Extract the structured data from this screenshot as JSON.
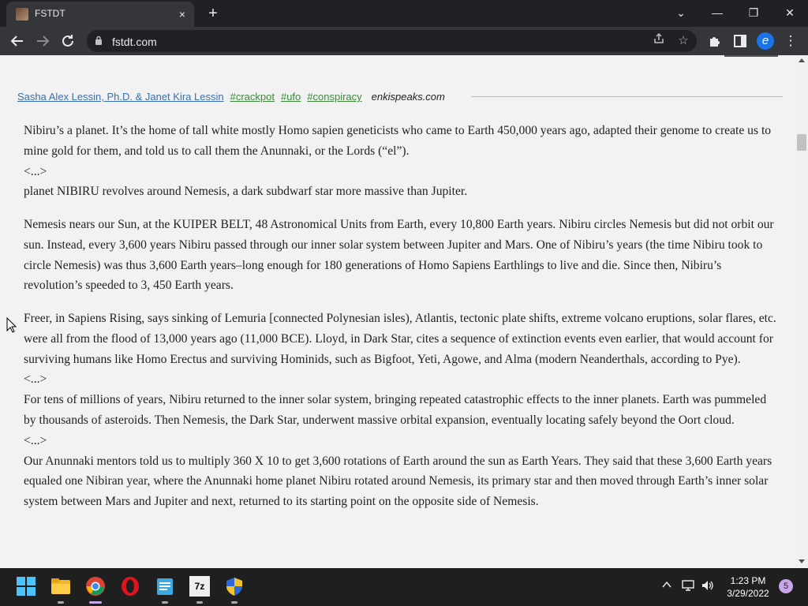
{
  "browser": {
    "tab_title": "FSTDT",
    "tab_close": "×",
    "new_tab": "+",
    "url": "fstdt.com",
    "profile_letter": "e",
    "window_controls": {
      "tab_search": "⌄",
      "minimize": "—",
      "restore": "❐",
      "close": "✕"
    }
  },
  "post": {
    "author": "Sasha Alex Lessin, Ph.D. & Janet Kira Lessin",
    "tags": [
      "#crackpot",
      "#ufo",
      "#conspiracy"
    ],
    "source": "enkispeaks.com",
    "paragraphs": [
      "Nibiru’s a planet. It’s the home of tall white mostly Homo sapien geneticists who came to Earth 450,000 years ago, adapted their genome to create us to mine gold for them, and told us to call them the Anunnaki, or the Lords (“el”).\n<...>\nplanet NIBIRU revolves around Nemesis, a dark subdwarf star more massive than Jupiter.",
      "Nemesis nears our Sun, at the KUIPER BELT, 48 Astronomical Units from Earth, every 10,800 Earth years. Nibiru circles Nemesis but did not orbit our sun. Instead, every 3,600 years Nibiru passed through our inner solar system between Jupiter and Mars. One of Nibiru’s years (the time Nibiru took to circle Nemesis) was thus 3,600 Earth years–long enough for 180 generations of Homo Sapiens Earthlings to live and die. Since then, Nibiru’s revolution’s speeded to 3, 450 Earth years.",
      "Freer, in Sapiens Rising, says sinking of Lemuria [connected Polynesian isles), Atlantis, tectonic plate shifts, extreme volcano eruptions, solar flares, etc. were all from the flood of 13,000 years ago (11,000 BCE). Lloyd, in Dark Star, cites a sequence of extinction events even earlier, that would account for surviving humans like Homo Erectus and surviving Hominids, such as Bigfoot, Yeti, Agowe, and Alma (modern Neanderthals, according to Pye).\n<...>\nFor tens of millions of years, Nibiru returned to the inner solar system, bringing repeated catastrophic effects to the inner planets. Earth was pummeled by thousands of asteroids. Then Nemesis, the Dark Star, underwent massive orbital expansion, eventually locating safely beyond the Oort cloud.\n<...>\nOur Anunnaki mentors told us to multiply 360 X 10 to get 3,600 rotations of Earth around the sun as Earth Years. They said that these 3,600 Earth years equaled one Nibiran year, where the Anunnaki home planet Nibiru rotated around Nemesis, its primary star and then moved through Earth’s inner solar system between Mars and Jupiter and next, returned to its starting point on the opposite side of Nemesis."
    ]
  },
  "taskbar": {
    "apps": [
      "windows-start",
      "file-explorer",
      "chrome",
      "opera",
      "notepad",
      "7zip",
      "security-shield"
    ],
    "zip_label": "7z",
    "time": "1:23 PM",
    "date": "3/29/2022",
    "notification_count": "5"
  },
  "colors": {
    "author_link": "#3a6fb5",
    "tag_link": "#3a8a3a",
    "page_bg": "#f2f2f2",
    "chrome_dark": "#202124"
  }
}
